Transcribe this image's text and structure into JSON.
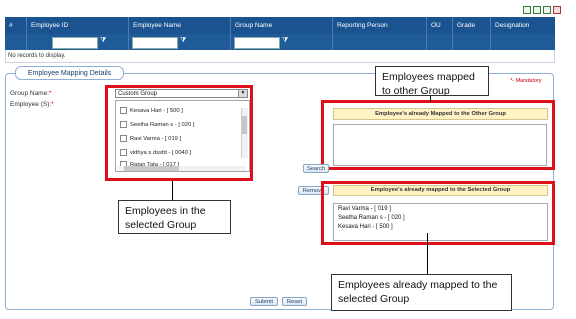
{
  "toolbar_icons": [
    "export-excel-icon",
    "export-pdf-icon",
    "export-word-icon",
    "close-icon"
  ],
  "grid": {
    "columns": [
      "#",
      "Employee ID",
      "Employee Name",
      "Group Name",
      "Reporting Person",
      "OU",
      "Grade",
      "Designation"
    ],
    "filter_icon": "⧩",
    "empty_message": "No records to display."
  },
  "section": {
    "title": "Employee Mapping Details",
    "mandatory_note": "*- Mandatory"
  },
  "form": {
    "group_label": "Group Name:",
    "employees_label": "Employee (S):",
    "required_mark": "*",
    "group_value": "Custom Group",
    "employees": [
      "Kesava Hari - [ 500 ]",
      "Seetha Raman s - [ 020 ]",
      "Ravi Varma - [ 019 ]",
      "vidhya s dssfd - [ 0040 ]",
      "Ratan Tata - [ 017 ]"
    ]
  },
  "other_group": {
    "header": "Employee's already Mapped to the Other Group",
    "search_button": "Search"
  },
  "selected_group": {
    "header": "Employee's already mapped to the Selected Group",
    "remove_button": "Remove",
    "employees": [
      "Ravi Varma - [ 019 ]",
      "Seetha Raman s - [ 020 ]",
      "Kesava Hari - [ 500 ]"
    ]
  },
  "buttons": {
    "submit": "Submit",
    "reset": "Reset"
  },
  "callouts": {
    "other_group": "Employees   mapped to other Group",
    "selected_group": "Employees  in  the selected Group",
    "already_mapped": "Employees already mapped to the selected Group"
  },
  "colors": {
    "grid_header": "#1b5390",
    "highlight": "#e0101a",
    "yellow_header": "#fff2c4"
  }
}
